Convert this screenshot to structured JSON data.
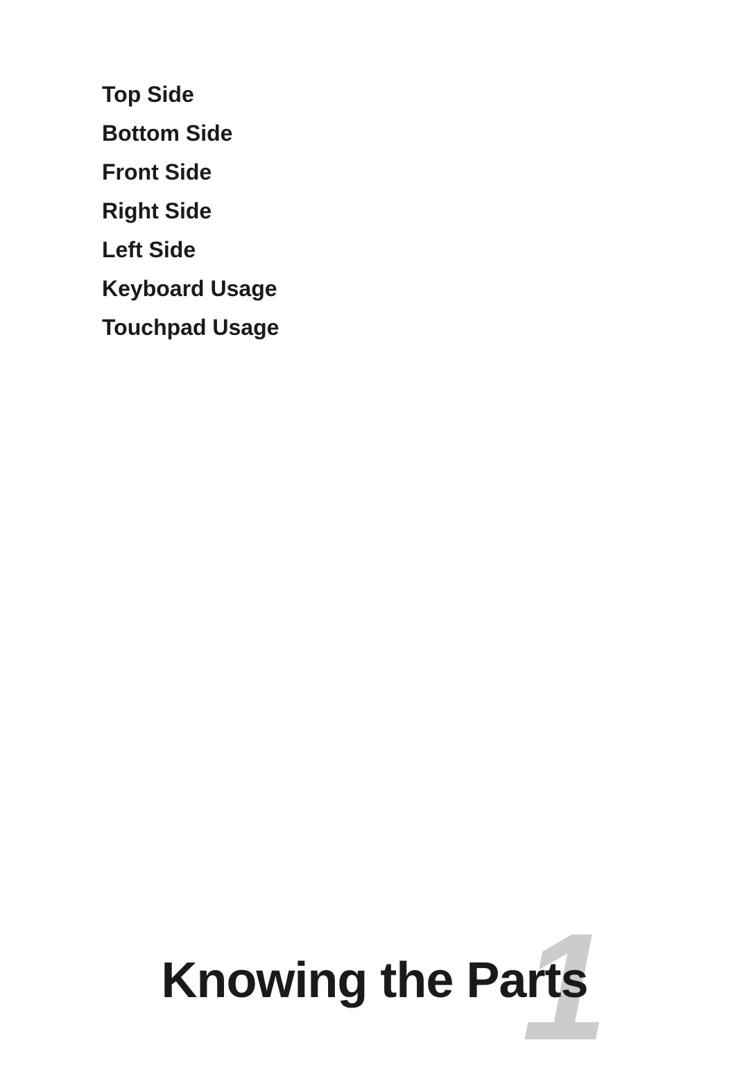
{
  "toc": {
    "items": [
      {
        "label": "Top Side"
      },
      {
        "label": "Bottom Side"
      },
      {
        "label": "Front Side"
      },
      {
        "label": "Right Side"
      },
      {
        "label": "Left Side"
      },
      {
        "label": "Keyboard Usage"
      },
      {
        "label": "Touchpad Usage"
      }
    ]
  },
  "chapter": {
    "number": "1",
    "title": "Knowing the Parts"
  }
}
